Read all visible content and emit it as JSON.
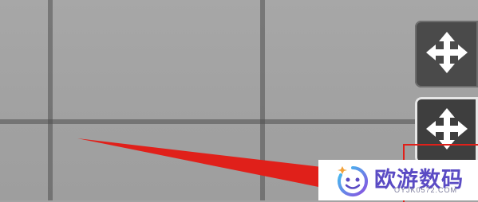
{
  "viewport": {
    "background_color": "#a3a3a3",
    "grid_color": "#505050"
  },
  "controls": {
    "move_buttons": [
      {
        "icon": "move-arrows-icon"
      },
      {
        "icon": "move-arrows-icon"
      }
    ]
  },
  "annotation": {
    "arrow_color": "#e0201a",
    "frame_color": "#e0201a"
  },
  "watermark": {
    "logo_icon": "smiley-logo-icon",
    "text": "欧游数码",
    "url": "OYJK0572.COM",
    "text_color": "#5a4bc4"
  }
}
